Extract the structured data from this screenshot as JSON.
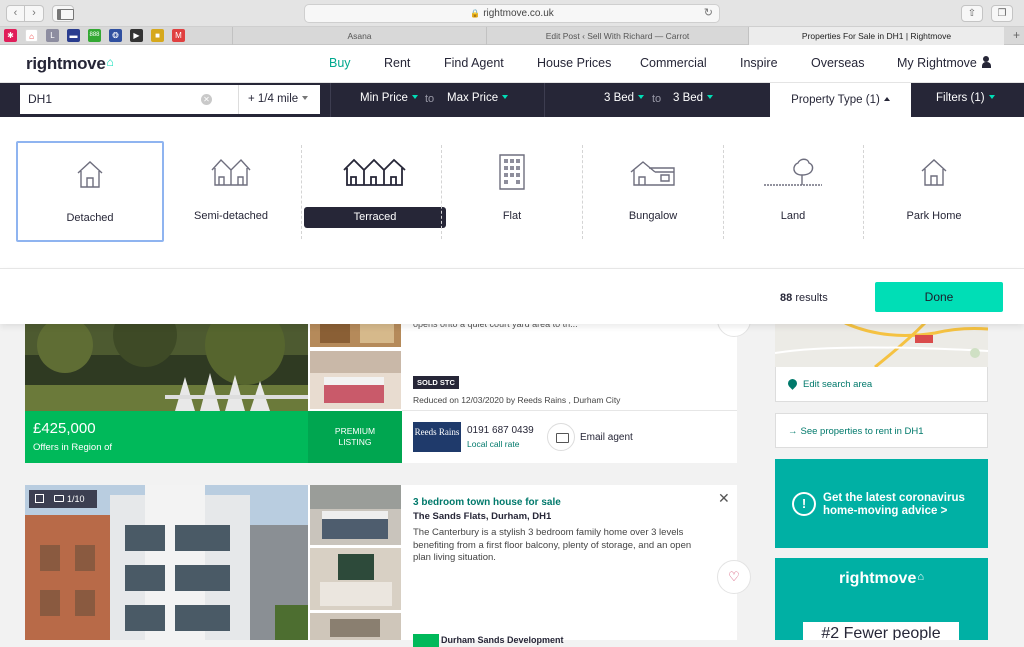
{
  "browser": {
    "url": "rightmove.co.uk",
    "tabs": [
      {
        "title": "Asana"
      },
      {
        "title": "Edit Post ‹ Sell With Richard — Carrot"
      },
      {
        "title": "Properties For Sale in DH1 | Rightmove"
      }
    ]
  },
  "header": {
    "logo": "rightmove",
    "nav": [
      "Buy",
      "Rent",
      "Find Agent",
      "House Prices",
      "Commercial",
      "Inspire",
      "Overseas",
      "My Rightmove"
    ]
  },
  "search": {
    "location": "DH1",
    "radius": "+ 1/4 mile",
    "min_price": "Min Price",
    "max_price": "Max Price",
    "to": "to",
    "min_bed": "3 Bed",
    "max_bed": "3 Bed",
    "property_type": "Property Type (1)",
    "filters": "Filters (1)"
  },
  "property_types": [
    "Detached",
    "Semi-detached",
    "Terraced",
    "Flat",
    "Bungalow",
    "Land",
    "Park Home"
  ],
  "results": {
    "count": "88",
    "label": "results",
    "done": "Done"
  },
  "listing1": {
    "desc_tail": "opens onto a quiet court yard area to th...",
    "badge": "SOLD STC",
    "reduced": "Reduced on 12/03/2020 by Reeds Rains , Durham City",
    "price": "£425,000",
    "price_qualifier": "Offers in Region of",
    "premium": "PREMIUM LISTING",
    "agent_logo": "Reeds Rains",
    "phone": "0191 687 0439",
    "call_rate": "Local call rate",
    "email": "Email agent"
  },
  "listing2": {
    "photo_count": "1/10",
    "title": "3 bedroom town house for sale",
    "address": "The Sands Flats, Durham, DH1",
    "description": "The Canterbury is a stylish 3 bedroom family home over 3 levels benefiting from a first floor balcony, plenty of storage, and an open plan living situation.",
    "footer_text": "Durham Sands Development"
  },
  "sidebar": {
    "edit_area": "Edit search area",
    "rent_link": "See properties to rent in DH1",
    "covid_line1": "Get the latest coronavirus",
    "covid_line2": "home-moving advice >",
    "promo_logo": "rightmove",
    "promo_text": "#2 Fewer people"
  },
  "colors": {
    "brand_dark": "#262637",
    "accent": "#00deb6",
    "green": "#00b95a",
    "teal": "#00b0a4"
  }
}
